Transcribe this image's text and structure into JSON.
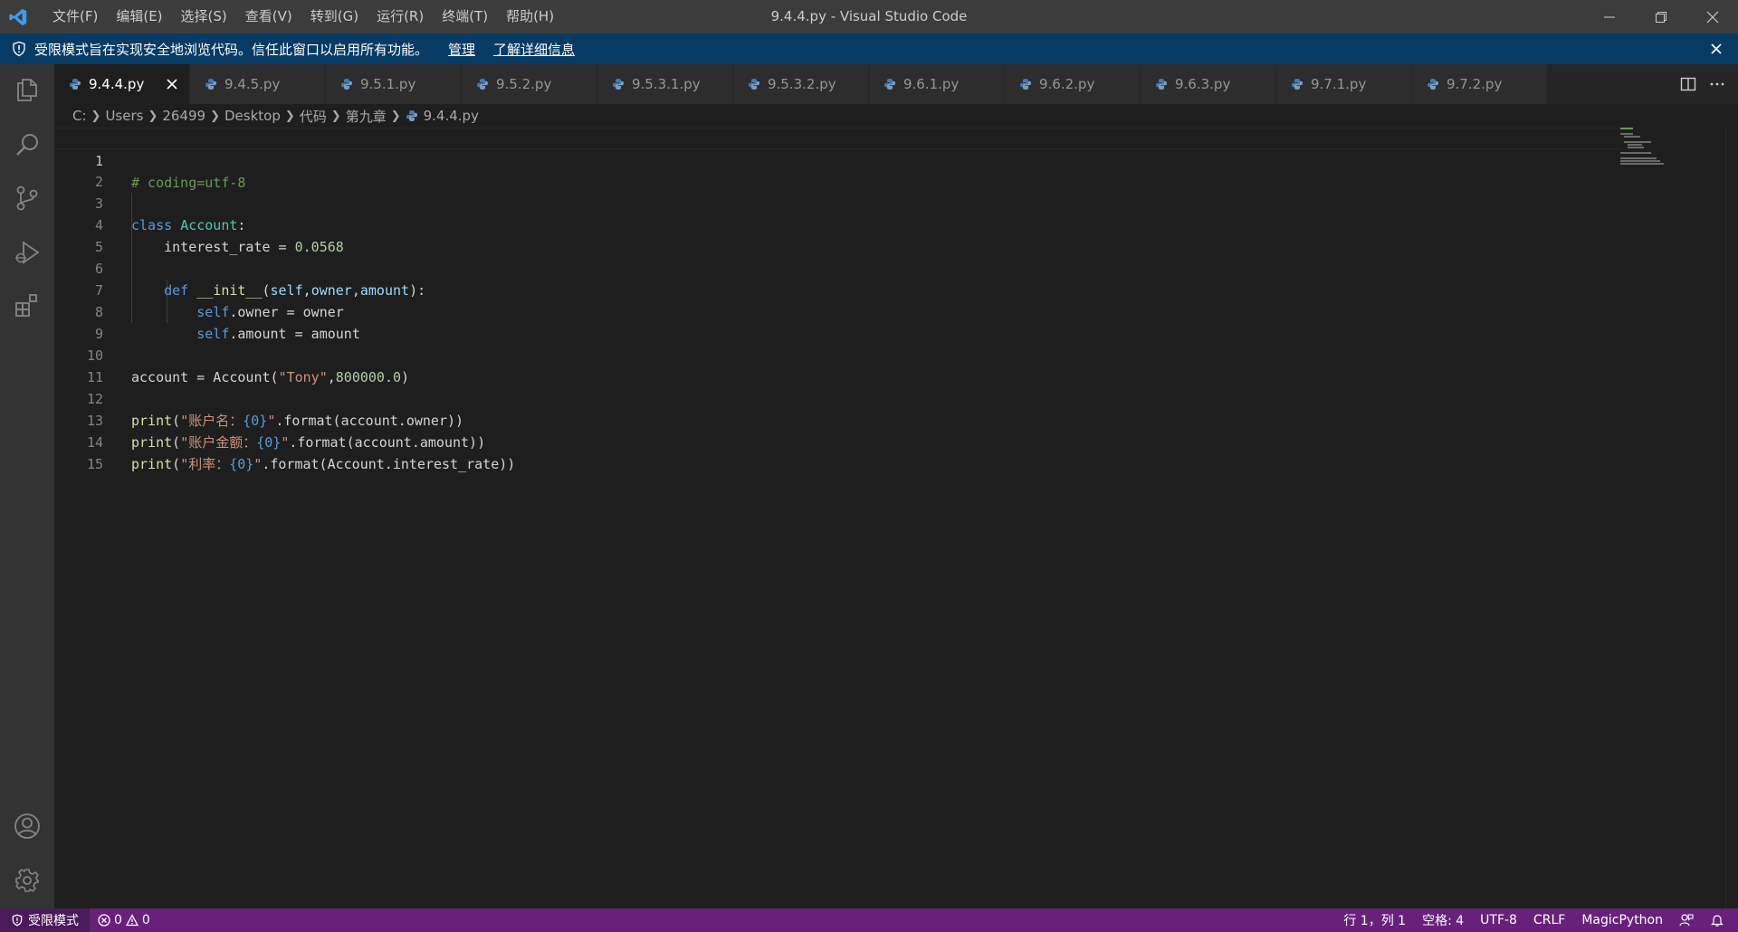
{
  "titlebar": {
    "menu": [
      "文件(F)",
      "编辑(E)",
      "选择(S)",
      "查看(V)",
      "转到(G)",
      "运行(R)",
      "终端(T)",
      "帮助(H)"
    ],
    "window_title": "9.4.4.py - Visual Studio Code"
  },
  "banner": {
    "message": "受限模式旨在实现安全地浏览代码。信任此窗口以启用所有功能。",
    "manage": "管理",
    "learn_more": "了解详细信息"
  },
  "tabs": [
    {
      "label": "9.4.4.py",
      "active": true
    },
    {
      "label": "9.4.5.py"
    },
    {
      "label": "9.5.1.py"
    },
    {
      "label": "9.5.2.py"
    },
    {
      "label": "9.5.3.1.py"
    },
    {
      "label": "9.5.3.2.py"
    },
    {
      "label": "9.6.1.py"
    },
    {
      "label": "9.6.2.py"
    },
    {
      "label": "9.6.3.py"
    },
    {
      "label": "9.7.1.py"
    },
    {
      "label": "9.7.2.py"
    }
  ],
  "breadcrumb": [
    "C:",
    "Users",
    "26499",
    "Desktop",
    "代码",
    "第九章",
    "9.4.4.py"
  ],
  "editor": {
    "current_line": 1,
    "line_numbers": [
      "1",
      "2",
      "3",
      "4",
      "5",
      "6",
      "7",
      "8",
      "9",
      "10",
      "11",
      "12",
      "13",
      "14",
      "15"
    ],
    "code": {
      "l1": "# coding=utf-8",
      "l3_kw": "class",
      "l3_cls": "Account",
      "l3_colon": ":",
      "l4_name": "interest_rate",
      "l4_eq": " = ",
      "l4_num": "0.0568",
      "l6_kw": "def",
      "l6_fn": "__init__",
      "l6_p1": "(",
      "l6_self": "self",
      "l6_c1": ",",
      "l6_owner": "owner",
      "l6_c2": ",",
      "l6_amount": "amount",
      "l6_end": "):",
      "l7_self": "self",
      "l7_rest": ".owner = owner",
      "l8_self": "self",
      "l8_rest": ".amount = amount",
      "l10_pre": "account = Account(",
      "l10_str": "\"Tony\"",
      "l10_comma": ",",
      "l10_num": "800000.0",
      "l10_end": ")",
      "l12_fn": "print",
      "l12_p": "(",
      "l12_str": "\"账户名：",
      "l12_esc": "{0}",
      "l12_q": "\"",
      "l12_rest": ".format(account.owner))",
      "l13_fn": "print",
      "l13_p": "(",
      "l13_str": "\"账户金额：",
      "l13_esc": "{0}",
      "l13_q": "\"",
      "l13_rest": ".format(account.amount))",
      "l14_fn": "print",
      "l14_p": "(",
      "l14_str": "\"利率：",
      "l14_esc": "{0}",
      "l14_q": "\"",
      "l14_rest": ".format(Account.interest_rate))"
    }
  },
  "statusbar": {
    "restricted": "受限模式",
    "errors": "0",
    "warnings": "0",
    "position": "行 1，列 1",
    "spaces": "空格: 4",
    "encoding": "UTF-8",
    "eol": "CRLF",
    "language": "MagicPython"
  },
  "colors": {
    "statusbar_bg": "#68217a",
    "banner_bg": "#063b66",
    "keyword": "#569cd6",
    "class_name": "#4ec9b0",
    "string": "#ce9178",
    "number": "#b5cea8",
    "comment": "#6a9955"
  }
}
